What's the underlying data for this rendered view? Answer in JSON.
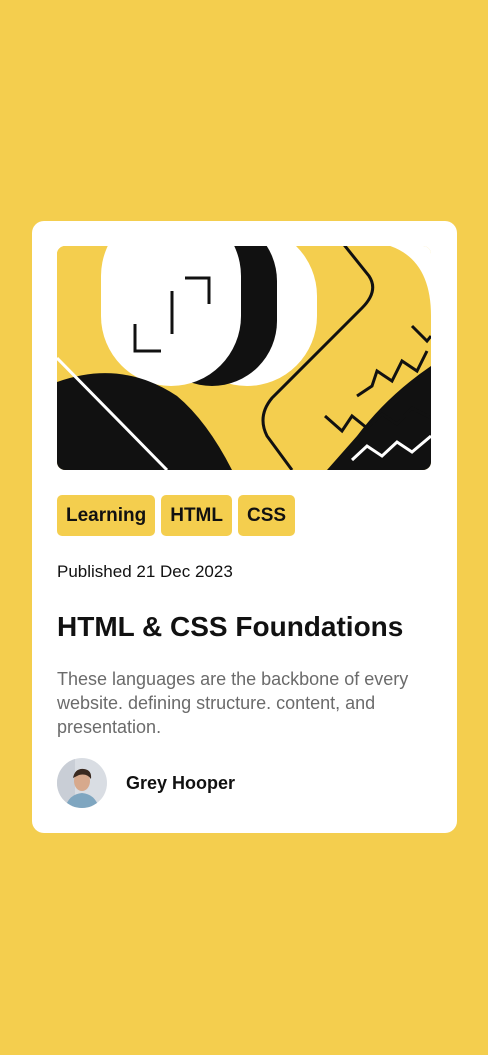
{
  "colors": {
    "background": "#F4CE4E",
    "card": "#FFFFFF",
    "text": "#111111",
    "muted": "#6B6B6B",
    "tag": "#F4CE4E"
  },
  "card": {
    "illustration_icon": "abstract-geometric-illustration",
    "tags": [
      "Learning",
      "HTML",
      "CSS"
    ],
    "published": "Published 21 Dec 2023",
    "title": "HTML & CSS Foundations",
    "description": "These languages are the backbone of every website. defining structure. content, and presentation.",
    "author": {
      "name": "Grey Hooper",
      "avatar_icon": "avatar-photo"
    }
  }
}
